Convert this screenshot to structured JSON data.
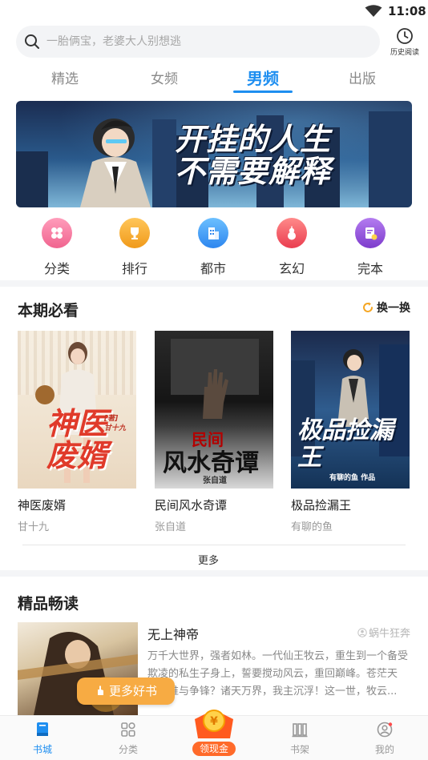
{
  "status_bar": {
    "time": "11:08"
  },
  "search": {
    "placeholder": "一胎俩宝，老婆大人别想逃",
    "history_label": "历史阅读"
  },
  "tabs": [
    {
      "label": "精选",
      "active": false
    },
    {
      "label": "女频",
      "active": false
    },
    {
      "label": "男频",
      "active": true
    },
    {
      "label": "出版",
      "active": false
    }
  ],
  "banner": {
    "slogan_line1": "开挂的人生",
    "slogan_line2": "不需要解释",
    "slide_count": 5,
    "active_slide": 1
  },
  "categories": [
    {
      "label": "分类",
      "icon": "grid-flower-icon",
      "color": "#f06a9a"
    },
    {
      "label": "排行",
      "icon": "trophy-icon",
      "color": "#f5a623"
    },
    {
      "label": "都市",
      "icon": "building-icon",
      "color": "#2f8ff0"
    },
    {
      "label": "玄幻",
      "icon": "gourd-icon",
      "color": "#f04a5a"
    },
    {
      "label": "完本",
      "icon": "book-check-icon",
      "color": "#8e4fd8"
    }
  ],
  "must_read": {
    "title": "本期必看",
    "refresh_label": "换一换",
    "books": [
      {
        "name": "神医废婿",
        "author": "甘十九",
        "cover_text": "神医废婿",
        "cover_sub": "[著] 甘十九"
      },
      {
        "name": "民间风水奇谭",
        "author": "张自道",
        "cover_text": "风水奇谭",
        "cover_top": "民间",
        "cover_sub": "张自道"
      },
      {
        "name": "极品捡漏王",
        "author": "有聊的鱼",
        "cover_text": "极品捡漏王",
        "cover_sub": "有聊的鱼 作品"
      }
    ],
    "more_label": "更多"
  },
  "featured": {
    "title": "精品畅读",
    "book_title": "无上神帝",
    "author": "蜗牛狂奔",
    "description": "万千大世界，强者如林。一代仙王牧云，重生到一个备受欺凌的私生子身上，誓要搅动风云，重回巅峰。苍茫天下，谁与争锋？诸天万界，我主沉浮！这一世，牧云..."
  },
  "more_books_label": "更多好书",
  "bottom_nav": {
    "items": [
      {
        "label": "书城",
        "icon": "book-icon",
        "active": true
      },
      {
        "label": "分类",
        "icon": "category-grid-icon",
        "active": false
      },
      {
        "label": "书架",
        "icon": "bookshelf-icon",
        "active": false
      },
      {
        "label": "我的",
        "icon": "profile-icon",
        "active": false
      }
    ],
    "cash_label": "领现金"
  },
  "colors": {
    "accent": "#1e8ef0",
    "orange": "#f7ab43",
    "cash": "#ff6a2a"
  }
}
